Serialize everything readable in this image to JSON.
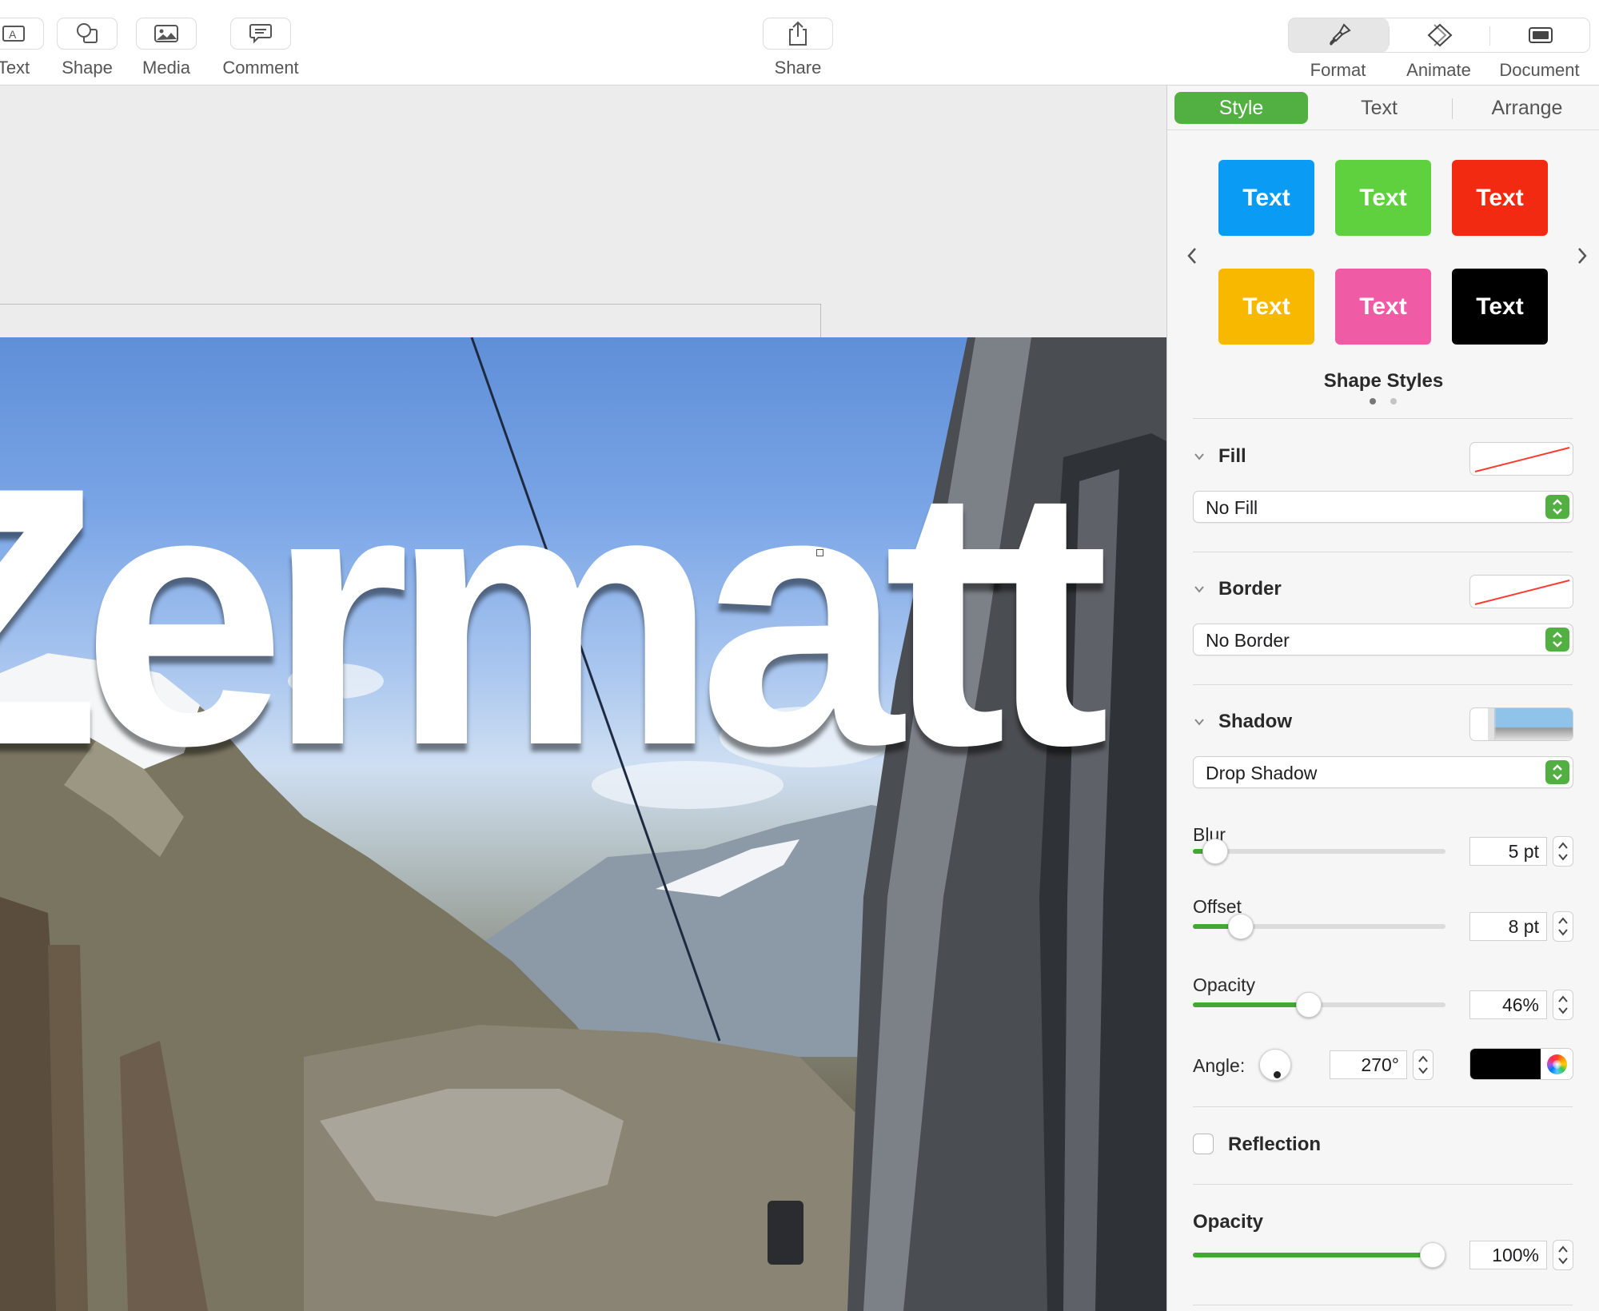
{
  "toolbar": {
    "left_items": [
      {
        "label": "Text",
        "icon": "text-box-icon"
      },
      {
        "label": "Shape",
        "icon": "shape-icon"
      },
      {
        "label": "Media",
        "icon": "photo-icon"
      },
      {
        "label": "Comment",
        "icon": "comment-icon"
      }
    ],
    "share": {
      "label": "Share",
      "icon": "share-icon"
    },
    "right_items": [
      {
        "label": "Format",
        "icon": "paintbrush-icon",
        "active": true
      },
      {
        "label": "Animate",
        "icon": "diamond-icon",
        "active": false
      },
      {
        "label": "Document",
        "icon": "document-icon",
        "active": false
      }
    ]
  },
  "slide": {
    "title_text": "Zermatt"
  },
  "inspector": {
    "tabs": [
      "Style",
      "Text",
      "Arrange"
    ],
    "active_tab": "Style",
    "shape_styles": {
      "title": "Shape Styles",
      "swatches": [
        {
          "label": "Text",
          "color": "#0a9cf5"
        },
        {
          "label": "Text",
          "color": "#5fd13f"
        },
        {
          "label": "Text",
          "color": "#f22a12"
        },
        {
          "label": "Text",
          "color": "#f8b800"
        },
        {
          "label": "Text",
          "color": "#ef5ba5"
        },
        {
          "label": "Text",
          "color": "#000000"
        }
      ],
      "page_count": 2,
      "current_page": 1
    },
    "fill": {
      "title": "Fill",
      "value": "No Fill"
    },
    "border": {
      "title": "Border",
      "value": "No Border"
    },
    "shadow": {
      "title": "Shadow",
      "value": "Drop Shadow",
      "blur": {
        "label": "Blur",
        "value": "5 pt",
        "fraction": 0.09
      },
      "offset": {
        "label": "Offset",
        "value": "8 pt",
        "fraction": 0.19
      },
      "opacity": {
        "label": "Opacity",
        "value": "46%",
        "fraction": 0.46
      },
      "angle": {
        "label": "Angle:",
        "value": "270°"
      },
      "color": "#000000"
    },
    "reflection": {
      "label": "Reflection",
      "checked": false
    },
    "opacity": {
      "label": "Opacity",
      "value": "100%",
      "fraction": 0.95
    },
    "accent_color": "#52b043"
  }
}
